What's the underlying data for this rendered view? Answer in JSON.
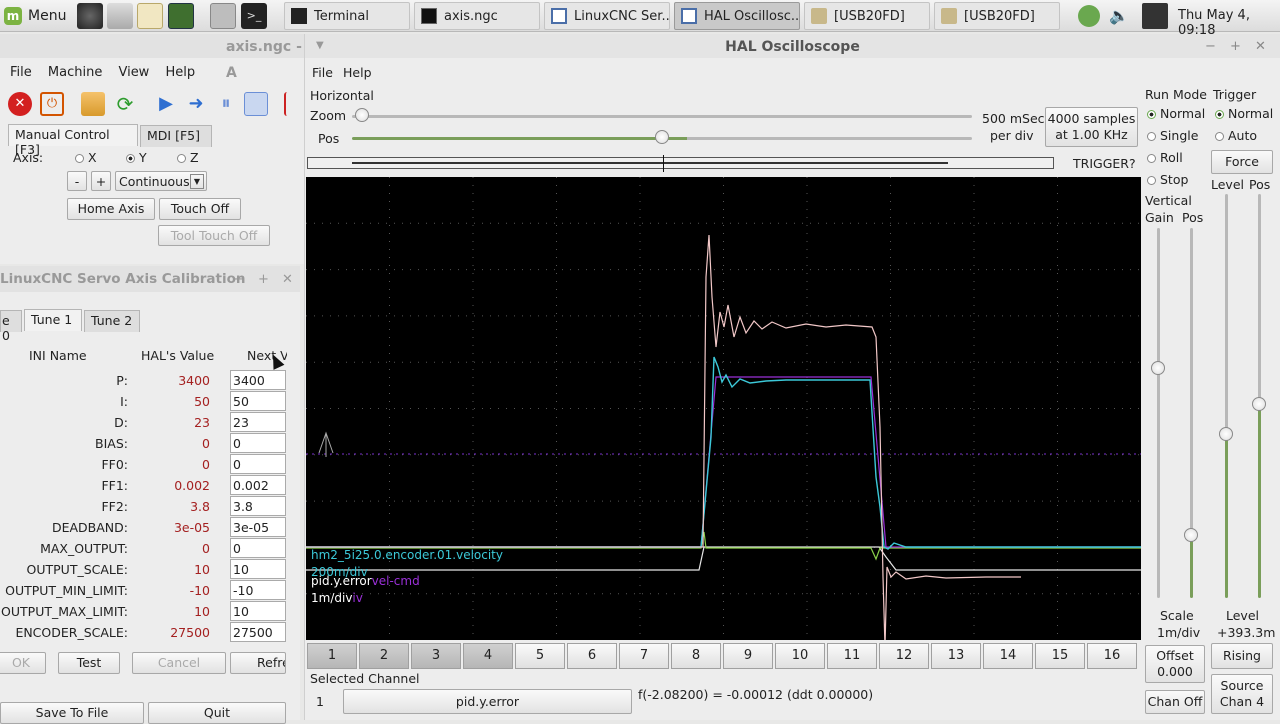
{
  "taskbar": {
    "menu_label": "Menu",
    "tasks": [
      {
        "label": "Terminal",
        "icon": "terminal-icon",
        "active": false
      },
      {
        "label": "axis.ngc",
        "icon": "axis-app-icon",
        "active": false
      },
      {
        "label": "LinuxCNC Ser...",
        "icon": "window-icon",
        "active": false
      },
      {
        "label": "HAL Oscillosc...",
        "icon": "window-icon",
        "active": true
      },
      {
        "label": "[USB20FD]",
        "icon": "folder-icon",
        "active": false
      },
      {
        "label": "[USB20FD]",
        "icon": "folder-icon",
        "active": false
      }
    ],
    "clock": "Thu May  4, 09:18"
  },
  "axis": {
    "title": "axis.ngc - A",
    "menus": [
      "File",
      "Machine",
      "View",
      "Help"
    ],
    "tab_manual": "Manual Control [F3]",
    "tab_mdi": "MDI [F5]",
    "axis_label": "Axis:",
    "axes": [
      "X",
      "Y",
      "Z"
    ],
    "selected_axis": "Y",
    "minus": "-",
    "plus": "+",
    "jog_mode": "Continuous",
    "home_axis": "Home Axis",
    "touch_off": "Touch Off",
    "tool_touch_off": "Tool Touch Off"
  },
  "calibration": {
    "title": "LinuxCNC Servo Axis Calibration",
    "tabs": [
      "e 0",
      "Tune 1",
      "Tune 2"
    ],
    "selected_tab": "Tune 1",
    "col_ini": "INI Name",
    "col_hal": "HAL's Value",
    "col_next": "Next V",
    "params": [
      {
        "name": "P:",
        "hal": "3400",
        "next": "3400"
      },
      {
        "name": "I:",
        "hal": "50",
        "next": "50"
      },
      {
        "name": "D:",
        "hal": "23",
        "next": "23"
      },
      {
        "name": "BIAS:",
        "hal": "0",
        "next": "0"
      },
      {
        "name": "FF0:",
        "hal": "0",
        "next": "0"
      },
      {
        "name": "FF1:",
        "hal": "0.002",
        "next": "0.002"
      },
      {
        "name": "FF2:",
        "hal": "3.8",
        "next": "3.8"
      },
      {
        "name": "DEADBAND:",
        "hal": "3e-05",
        "next": "3e-05"
      },
      {
        "name": "MAX_OUTPUT:",
        "hal": "0",
        "next": "0"
      },
      {
        "name": "OUTPUT_SCALE:",
        "hal": "10",
        "next": "10"
      },
      {
        "name": "OUTPUT_MIN_LIMIT:",
        "hal": "-10",
        "next": "-10"
      },
      {
        "name": "OUTPUT_MAX_LIMIT:",
        "hal": "10",
        "next": "10"
      },
      {
        "name": "ENCODER_SCALE:",
        "hal": "27500",
        "next": "27500"
      }
    ],
    "ok": "OK",
    "test": "Test",
    "cancel": "Cancel",
    "refresh": "Refre",
    "save": "Save To File",
    "quit": "Quit"
  },
  "scope": {
    "title": "HAL Oscilloscope",
    "menus": [
      "File",
      "Help"
    ],
    "horizontal": "Horizontal",
    "zoom": "Zoom",
    "pos": "Pos",
    "zoom_level": 0.01,
    "pos_level": 0.5,
    "rate_line1": "500 mSec",
    "rate_line2": "per div",
    "samples_line1": "4000 samples",
    "samples_line2": "at 1.00 KHz",
    "trigger_status": "TRIGGER?",
    "run_mode": "Run Mode",
    "run_modes": [
      "Normal",
      "Single",
      "Roll",
      "Stop"
    ],
    "run_selected": "Normal",
    "trigger": "Trigger",
    "trigger_modes": [
      "Normal",
      "Auto"
    ],
    "trigger_selected": "Normal",
    "force": "Force",
    "level": "Level",
    "pos_label": "Pos",
    "vertical": "Vertical",
    "gain": "Gain",
    "scale_label": "Scale",
    "scale_value": "1m/div",
    "level_value": "+393.3m",
    "offset_label": "Offset",
    "offset_value": "0.000",
    "rising": "Rising",
    "chan_off": "Chan Off",
    "source_label": "Source",
    "source_value": "Chan 4",
    "channels": [
      "1",
      "2",
      "3",
      "4",
      "5",
      "6",
      "7",
      "8",
      "9",
      "10",
      "11",
      "12",
      "13",
      "14",
      "15",
      "16"
    ],
    "active_channels": [
      "1",
      "2",
      "3",
      "4"
    ],
    "selected_channel_label": "Selected Channel",
    "selected_channel_num": "1",
    "selected_channel_name": "pid.y.error",
    "readout": "f(-2.08200) = -0.00012 (ddt  0.00000)",
    "trace_labels": [
      {
        "text": "hm2_5i25.0.encoder.01.velocity",
        "color": "#3cc8d8"
      },
      {
        "text": "200m/div",
        "color": "#3cc8d8"
      },
      {
        "text": "pid.y.error",
        "color": "#ffffff"
      },
      {
        "text": "vel-cmd",
        "color": "#9a30d8"
      },
      {
        "text": "1m/div",
        "color": "#ffffff"
      },
      {
        "text": "iv",
        "color": "#9a30d8"
      }
    ]
  }
}
